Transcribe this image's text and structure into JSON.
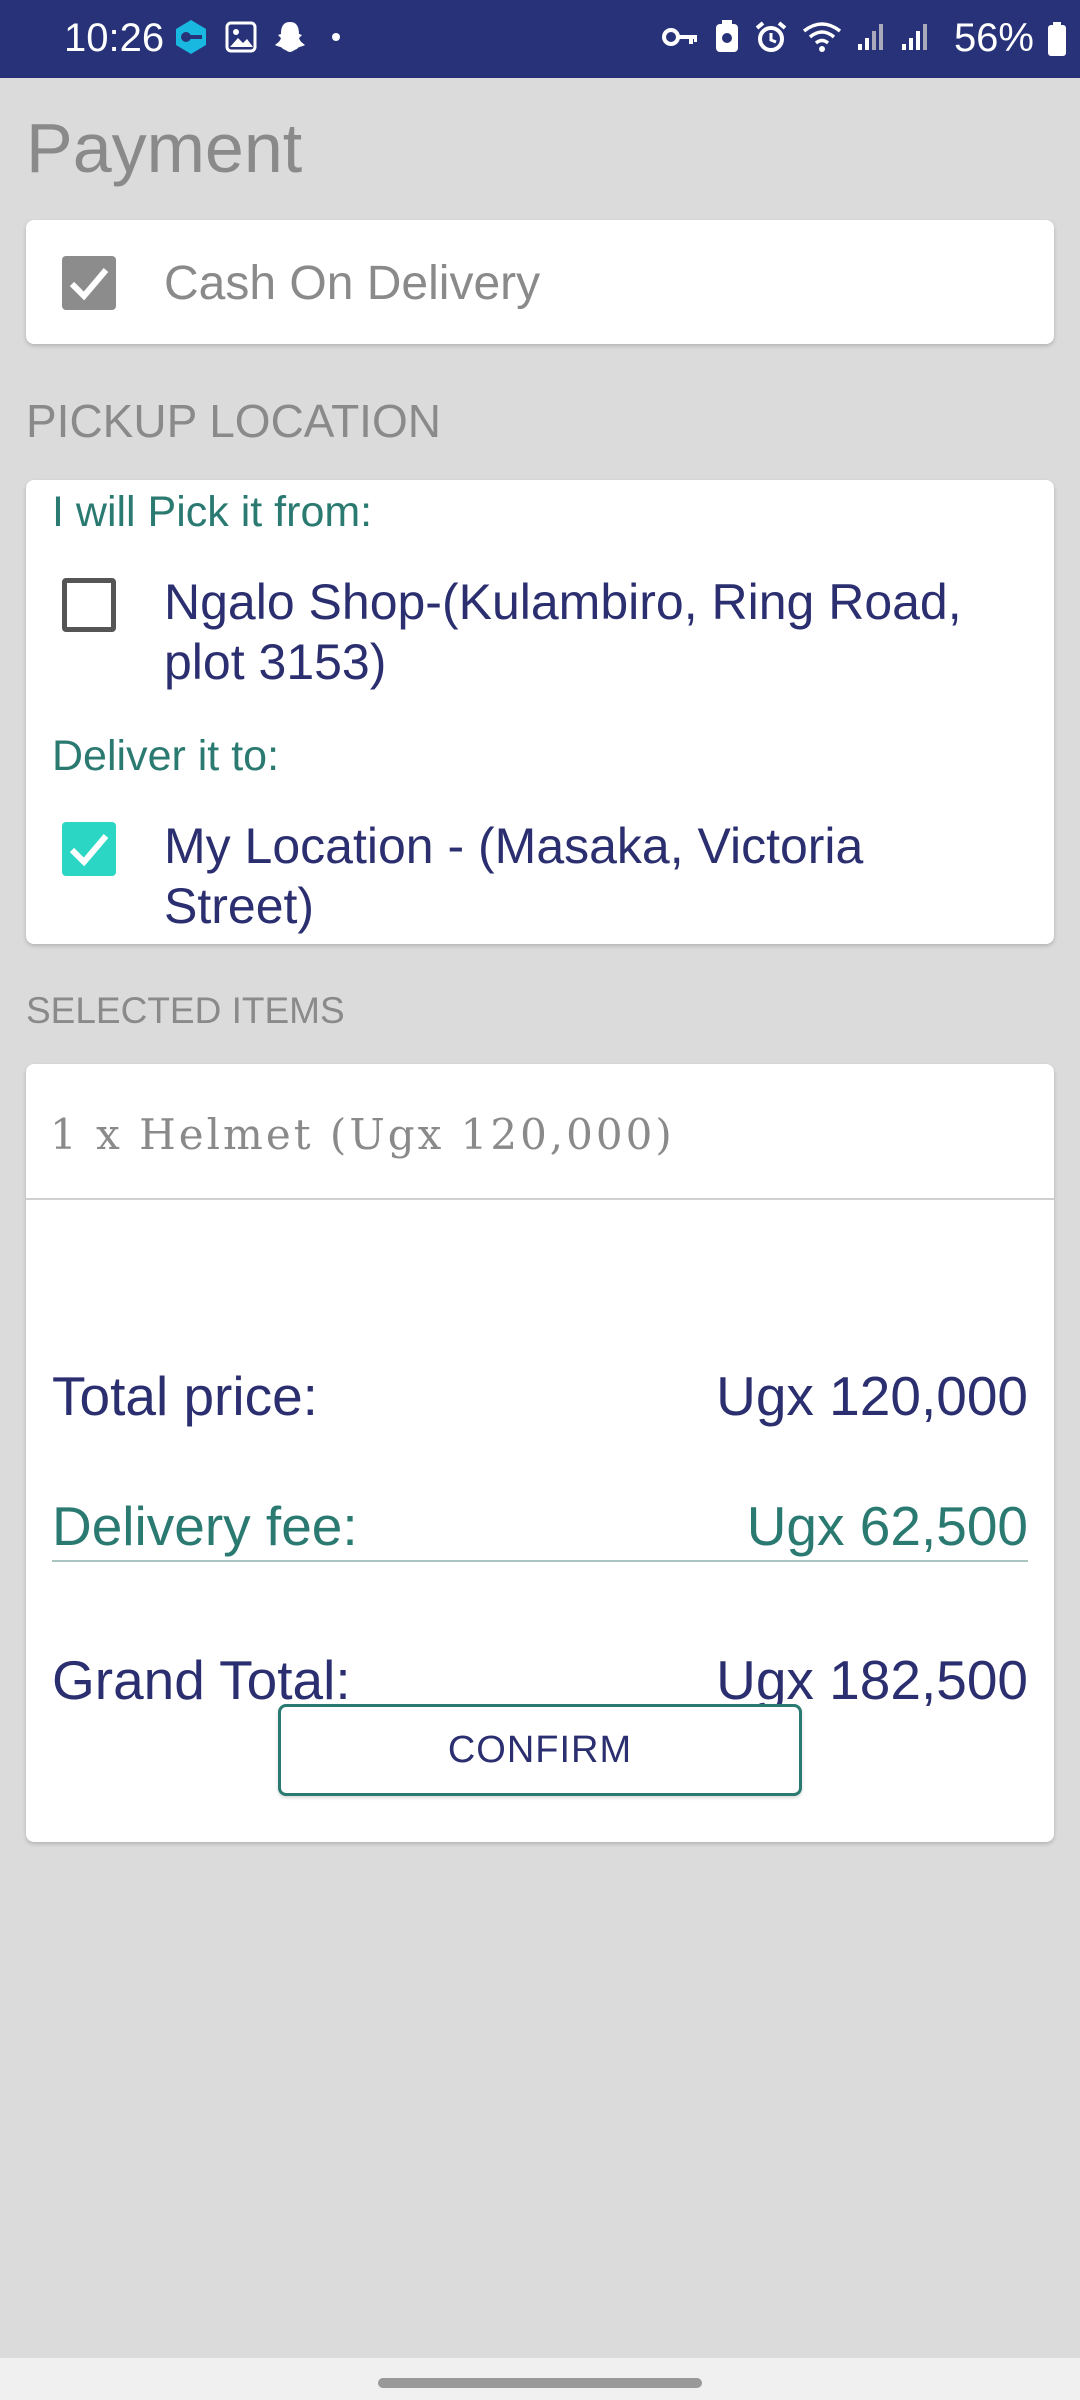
{
  "status_bar": {
    "time": "10:26",
    "battery_percent": "56%",
    "left_icons": [
      "vpn-key-app-icon",
      "gallery-icon",
      "snapchat-icon",
      "dot-icon"
    ],
    "right_icons": [
      "key-icon",
      "data-saver-icon",
      "alarm-icon",
      "wifi-icon",
      "signal-icon",
      "signal-icon"
    ]
  },
  "page": {
    "title": "Payment"
  },
  "payment": {
    "method_label": "Cash On Delivery",
    "method_checked": true
  },
  "pickup": {
    "header": "PICKUP LOCATION",
    "pick_from_label": "I will Pick it from:",
    "pick_option": "Ngalo Shop-(Kulambiro, Ring Road, plot 3153)",
    "pick_checked": false,
    "deliver_to_label": "Deliver it to:",
    "deliver_option": "My Location - (Masaka, Victoria Street)",
    "deliver_checked": true
  },
  "selected_items": {
    "header": "SELECTED ITEMS",
    "items": [
      "1 x  Helmet  (Ugx 120,000)"
    ]
  },
  "totals": {
    "total_price_label": "Total price:",
    "total_price_value": "Ugx 120,000",
    "delivery_fee_label": "Delivery fee:",
    "delivery_fee_value": "Ugx 62,500",
    "grand_total_label": "Grand Total:",
    "grand_total_value": "Ugx 182,500"
  },
  "actions": {
    "confirm_label": "CONFIRM"
  },
  "colors": {
    "status_bar": "#283279",
    "accent_teal": "#2a7a72",
    "checkbox_on": "#2bd6c4",
    "text_navy": "#2b2f70"
  }
}
